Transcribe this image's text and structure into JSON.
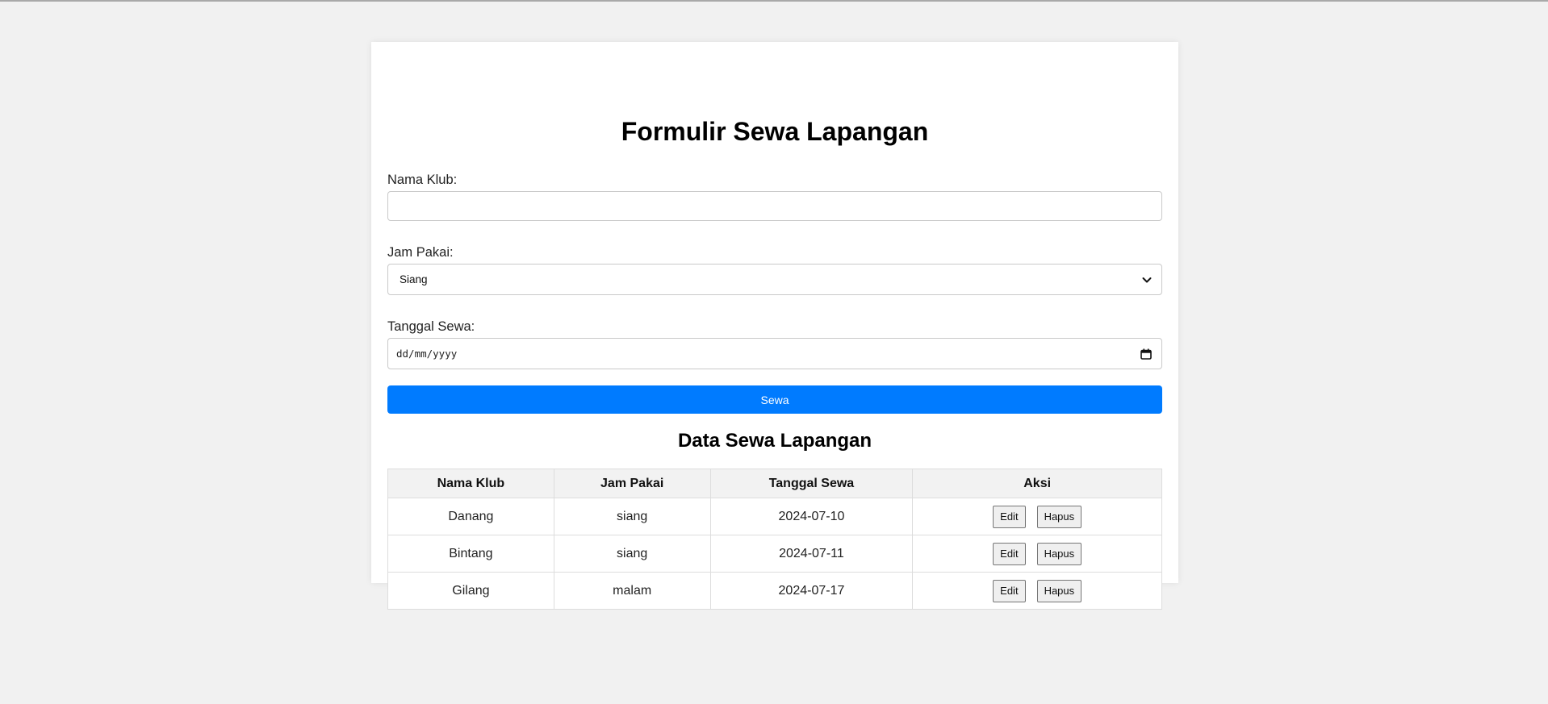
{
  "form": {
    "title": "Formulir Sewa Lapangan",
    "club_name_label": "Nama Klub:",
    "club_name_value": "",
    "time_label": "Jam Pakai:",
    "time_selected": "Siang",
    "date_label": "Tanggal Sewa:",
    "date_placeholder": "dd/mm/yyyy",
    "submit_label": "Sewa"
  },
  "table": {
    "title": "Data Sewa Lapangan",
    "headers": [
      "Nama Klub",
      "Jam Pakai",
      "Tanggal Sewa",
      "Aksi"
    ],
    "rows": [
      {
        "club": "Danang",
        "time": "siang",
        "date": "2024-07-10",
        "edit_label": "Edit",
        "delete_label": "Hapus"
      },
      {
        "club": "Bintang",
        "time": "siang",
        "date": "2024-07-11",
        "edit_label": "Edit",
        "delete_label": "Hapus"
      },
      {
        "club": "Gilang",
        "time": "malam",
        "date": "2024-07-17",
        "edit_label": "Edit",
        "delete_label": "Hapus"
      }
    ]
  },
  "icons": {
    "select": "chevron-down-icon",
    "date": "calendar-icon"
  },
  "colors": {
    "background": "#f1f1f1",
    "card": "#ffffff",
    "primary_button": "#007bff",
    "table_header": "#f2f2f2"
  }
}
